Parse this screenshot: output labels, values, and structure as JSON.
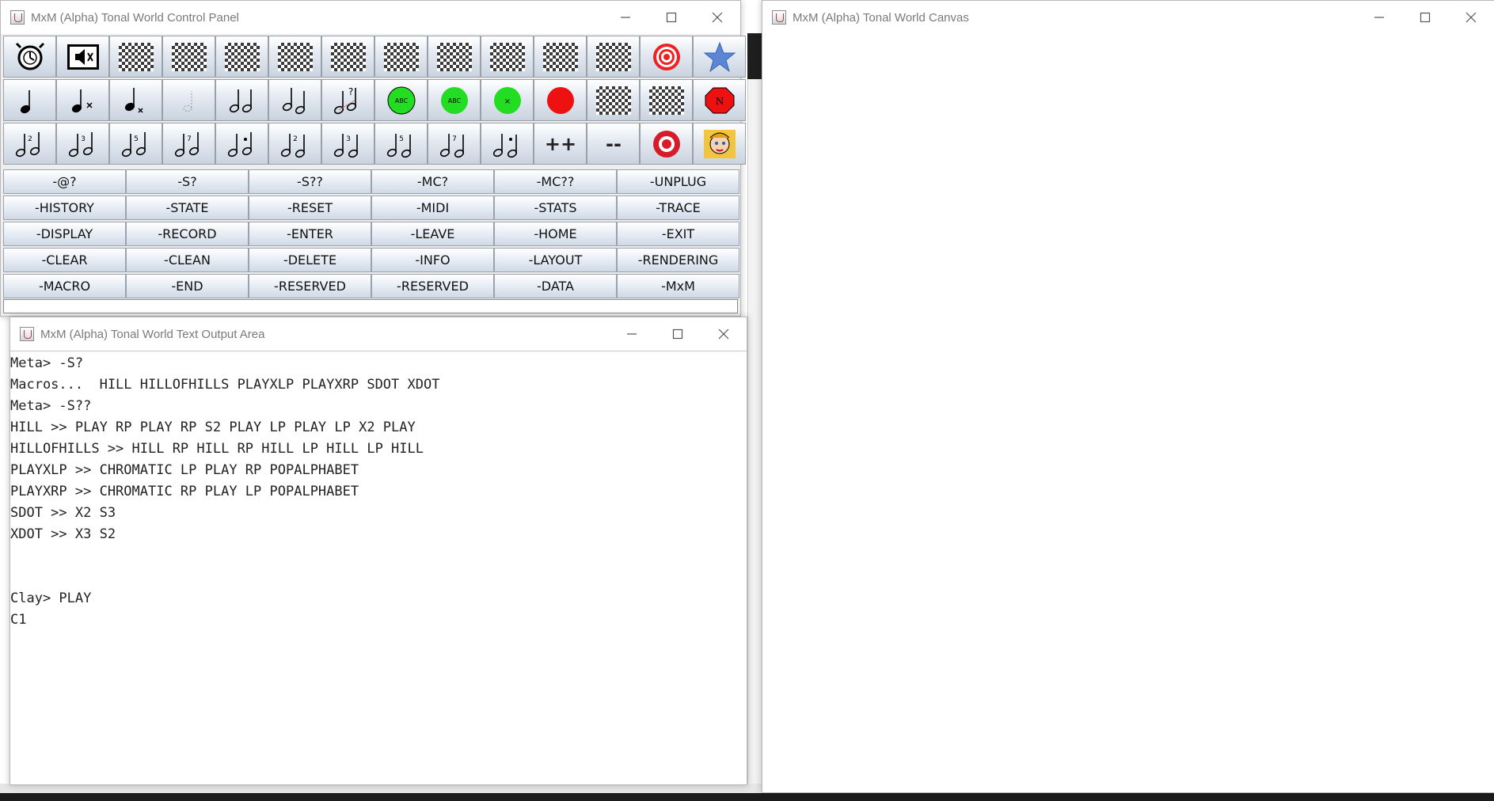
{
  "control_panel": {
    "title": "MxM (Alpha) Tonal World Control Panel",
    "icon_rows": [
      [
        {
          "icon": "alarm-clock-icon"
        },
        {
          "icon": "speaker-mute-icon"
        },
        {
          "icon": "checker-icon"
        },
        {
          "icon": "checker-icon"
        },
        {
          "icon": "checker-icon"
        },
        {
          "icon": "checker-icon"
        },
        {
          "icon": "checker-icon"
        },
        {
          "icon": "checker-icon"
        },
        {
          "icon": "checker-icon"
        },
        {
          "icon": "checker-icon"
        },
        {
          "icon": "checker-icon"
        },
        {
          "icon": "checker-icon"
        },
        {
          "icon": "target-icon"
        },
        {
          "icon": "star-icon"
        }
      ],
      [
        {
          "icon": "quarter-note-icon"
        },
        {
          "icon": "note-x-icon"
        },
        {
          "icon": "note-x-small-icon"
        },
        {
          "icon": "ghost-note-icon"
        },
        {
          "icon": "two-notes-icon"
        },
        {
          "icon": "two-notes-low-icon"
        },
        {
          "icon": "notes-question-icon"
        },
        {
          "icon": "abc-green-circle-icon",
          "label": "ABC"
        },
        {
          "icon": "abc-green-circle-small-icon",
          "label": "ABC"
        },
        {
          "icon": "x-green-circle-icon",
          "label": "X"
        },
        {
          "icon": "red-circle-icon"
        },
        {
          "icon": "checker-icon"
        },
        {
          "icon": "checker-icon"
        },
        {
          "icon": "octagon-n-icon",
          "label": "N"
        }
      ],
      [
        {
          "icon": "interval-2-icon",
          "label": "2"
        },
        {
          "icon": "interval-3-icon",
          "label": "3"
        },
        {
          "icon": "interval-5-icon",
          "label": "5"
        },
        {
          "icon": "interval-7-icon",
          "label": "7"
        },
        {
          "icon": "interval-dot-icon",
          "label": "."
        },
        {
          "icon": "interval-2b-icon",
          "label": "2"
        },
        {
          "icon": "interval-3b-icon",
          "label": "3"
        },
        {
          "icon": "interval-5b-icon",
          "label": "5"
        },
        {
          "icon": "interval-7b-icon",
          "label": "7"
        },
        {
          "icon": "interval-dotb-icon",
          "label": "."
        },
        {
          "icon": "plus-plus-icon",
          "label": "++"
        },
        {
          "icon": "minus-minus-icon",
          "label": "--"
        },
        {
          "icon": "red-ring-icon"
        },
        {
          "icon": "comic-face-icon"
        }
      ]
    ],
    "text_buttons": [
      [
        "-@?",
        "-S?",
        "-S??",
        "-MC?",
        "-MC??",
        "-UNPLUG"
      ],
      [
        "-HISTORY",
        "-STATE",
        "-RESET",
        "-MIDI",
        "-STATS",
        "-TRACE"
      ],
      [
        "-DISPLAY",
        "-RECORD",
        "-ENTER",
        "-LEAVE",
        "-HOME",
        "-EXIT"
      ],
      [
        "-CLEAR",
        "-CLEAN",
        "-DELETE",
        "-INFO",
        "-LAYOUT",
        "-RENDERING"
      ],
      [
        "-MACRO",
        "-END",
        "-RESERVED",
        "-RESERVED",
        "-DATA",
        "-MxM"
      ]
    ],
    "command_input": ""
  },
  "canvas": {
    "title": "MxM (Alpha) Tonal World Canvas"
  },
  "text_output": {
    "title": "MxM (Alpha) Tonal World Text Output Area",
    "lines": [
      "Meta> -S?",
      "Macros...  HILL HILLOFHILLS PLAYXLP PLAYXRP SDOT XDOT",
      "Meta> -S??",
      "HILL >> PLAY RP PLAY RP S2 PLAY LP PLAY LP X2 PLAY",
      "HILLOFHILLS >> HILL RP HILL RP HILL LP HILL LP HILL",
      "PLAYXLP >> CHROMATIC LP PLAY RP POPALPHABET",
      "PLAYXRP >> CHROMATIC RP PLAY LP POPALPHABET",
      "SDOT >> X2 S3",
      "XDOT >> X3 S2",
      "",
      "",
      "Clay> PLAY",
      "C1"
    ]
  },
  "colors": {
    "title_text": "#7a7a7a",
    "button_gradient_top": "#ffffff",
    "button_gradient_bottom": "#cfd9e5",
    "green": "#22dd22",
    "red": "#ee1111"
  }
}
